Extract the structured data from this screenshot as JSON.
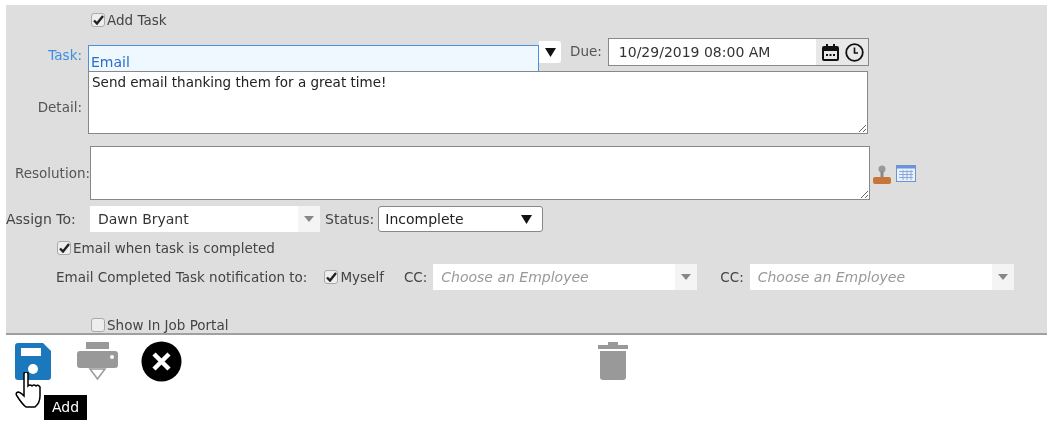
{
  "add_task": {
    "label": "Add Task",
    "checked": true
  },
  "task": {
    "label": "Task:",
    "value": "Email"
  },
  "due": {
    "label": "Due:",
    "value": "10/29/2019 08:00 AM"
  },
  "detail": {
    "label": "Detail:",
    "value": "Send email thanking them for a great time!"
  },
  "resolution": {
    "label": "Resolution:"
  },
  "assign_to": {
    "label": "Assign To:",
    "value": "Dawn Bryant"
  },
  "status": {
    "label": "Status:",
    "value": "Incomplete"
  },
  "email_when_completed": {
    "label": "Email when task is completed",
    "checked": true
  },
  "notification": {
    "label": "Email Completed Task notification to:",
    "myself": {
      "label": "Myself",
      "checked": true
    },
    "cc": [
      {
        "label": "CC:",
        "placeholder": "Choose an Employee"
      },
      {
        "label": "CC:",
        "placeholder": "Choose an Employee"
      }
    ]
  },
  "show_in_job_portal": {
    "label": "Show In Job Portal",
    "checked": false
  },
  "toolbar": {
    "tooltip": "Add"
  }
}
